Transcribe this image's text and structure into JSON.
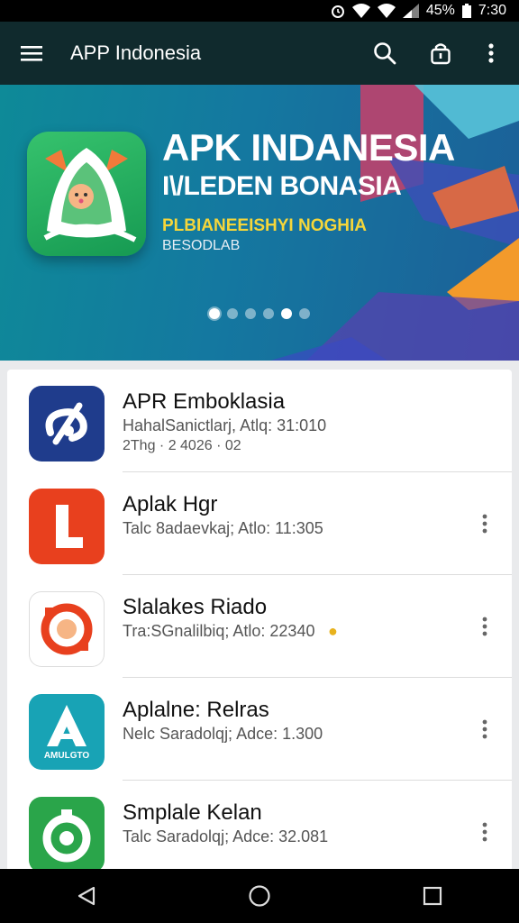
{
  "status_bar": {
    "battery_percent": "45%",
    "time": "7:30",
    "icons": [
      "alarm-icon",
      "wifi-icon",
      "signal-icon",
      "battery-icon"
    ]
  },
  "app_bar": {
    "title": "APP Indonesia",
    "icons": [
      "menu-icon",
      "search-icon",
      "lock-icon",
      "more-vert-icon"
    ]
  },
  "banner": {
    "headline": "APK INDANESIA",
    "subheadline": "I\\/LEDEN BONASIA",
    "tagline": "PLBIANEEISHYI NOGHIA",
    "small_text": "BESODLAB",
    "slide_count": 6,
    "active_slide": 1
  },
  "apps": [
    {
      "name": "APR Emboklasia",
      "meta": "HahalSanictlarj, Atlq: 31:010",
      "meta2": "2Thg · 2 4026 · 02",
      "icon": "swirl-logo-icon",
      "color": "#1f3c8c"
    },
    {
      "name": "Aplak Hgr",
      "meta": "Talc 8adaevkaj; Atlo: 11:305",
      "icon": "letter-l-icon",
      "color": "#e8401e"
    },
    {
      "name": "Slalakes Riado",
      "meta": "Tra:SGnalilbiq; Atlo: 22340",
      "icon": "camera-lens-icon",
      "color": "#ffffff"
    },
    {
      "name": "Aplalne: Relras",
      "meta": "Nelc Saradolqj; Adce: 1.300",
      "icon": "letter-a-icon",
      "color": "#18a3b5",
      "icon_label": "AMULGTO"
    },
    {
      "name": "Smplale Kelan",
      "meta": "Talc Saradolqj; Adce: 32.081",
      "icon": "ring-icon",
      "color": "#2aa54a"
    }
  ],
  "nav_bar": {
    "icons": [
      "back-icon",
      "home-icon",
      "recents-icon"
    ]
  }
}
